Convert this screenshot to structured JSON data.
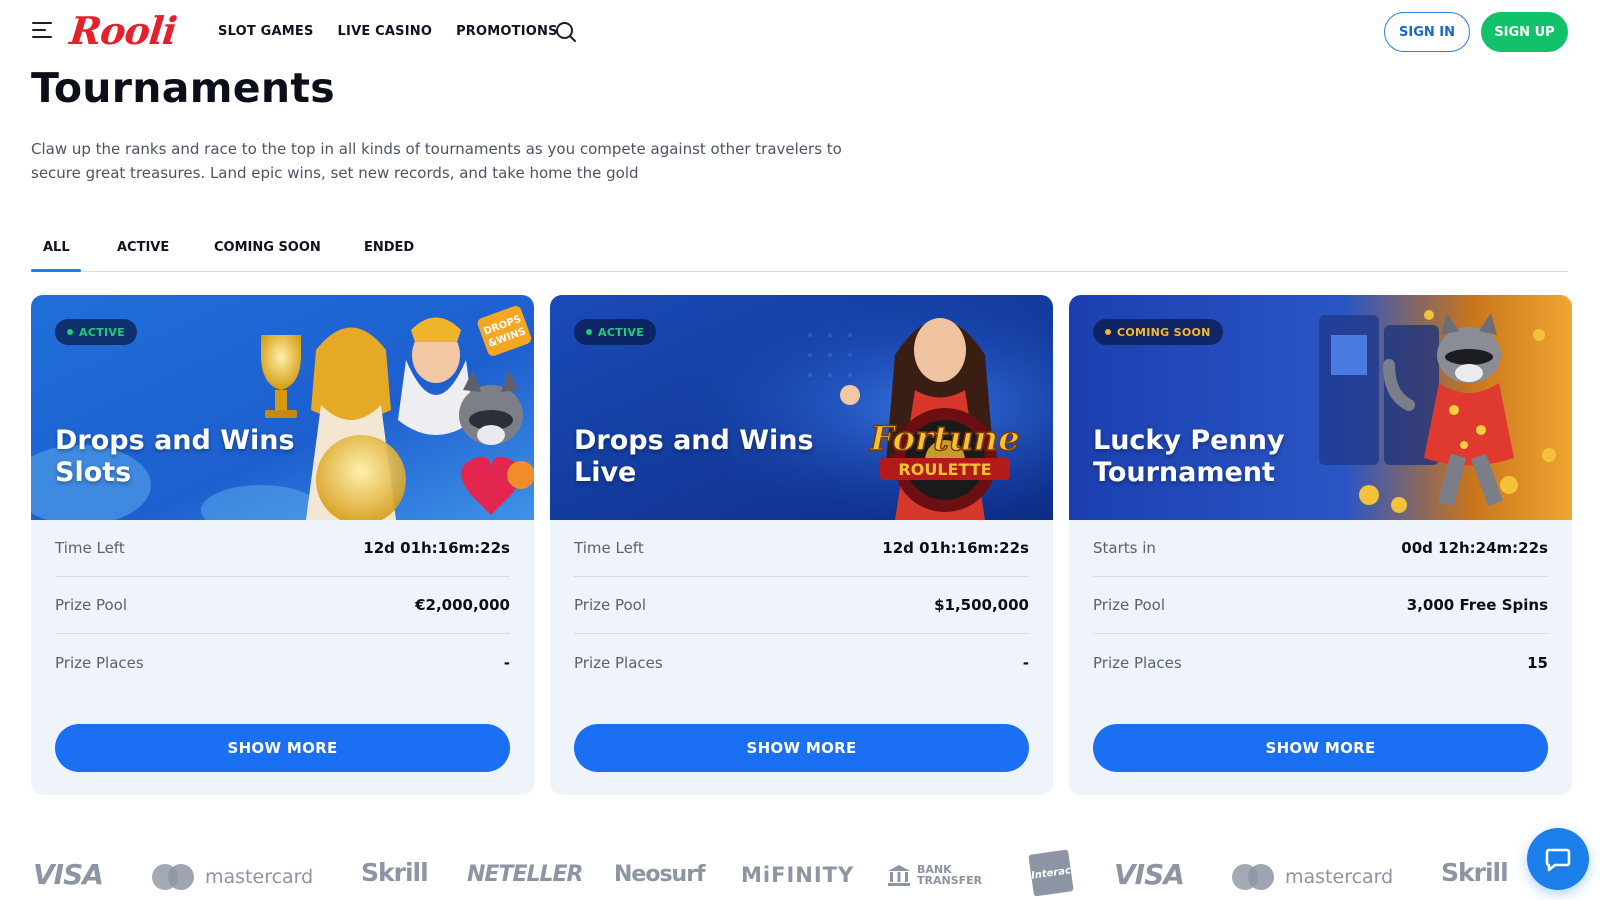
{
  "header": {
    "logo_text": "Rooli",
    "nav": [
      {
        "label": "SLOT GAMES"
      },
      {
        "label": "LIVE CASINO"
      },
      {
        "label": "PROMOTIONS"
      }
    ],
    "sign_in": "SIGN IN",
    "sign_up": "SIGN UP"
  },
  "page": {
    "title": "Tournaments",
    "intro": "Claw up the ranks and race to the top in all kinds of tournaments as you compete against other travelers to secure great treasures. Land epic wins, set new records, and take home the gold"
  },
  "tabs": [
    {
      "label": "ALL",
      "selected": true
    },
    {
      "label": "ACTIVE",
      "selected": false
    },
    {
      "label": "COMING SOON",
      "selected": false
    },
    {
      "label": "ENDED",
      "selected": false
    }
  ],
  "cards": [
    {
      "status": "ACTIVE",
      "title": "Drops and Wins Slots",
      "rows": [
        {
          "label": "Time Left",
          "value": "12d 01h:16m:22s"
        },
        {
          "label": "Prize Pool",
          "value": "€2,000,000"
        },
        {
          "label": "Prize Places",
          "value": "-"
        }
      ],
      "button": "SHOW MORE"
    },
    {
      "status": "ACTIVE",
      "title": "Drops and Wins Live",
      "rows": [
        {
          "label": "Time Left",
          "value": "12d 01h:16m:22s"
        },
        {
          "label": "Prize Pool",
          "value": "$1,500,000"
        },
        {
          "label": "Prize Places",
          "value": "-"
        }
      ],
      "button": "SHOW MORE"
    },
    {
      "status": "COMING SOON",
      "title": "Lucky Penny Tournament",
      "rows": [
        {
          "label": "Starts in",
          "value": "00d 12h:24m:22s"
        },
        {
          "label": "Prize Pool",
          "value": "3,000 Free Spins"
        },
        {
          "label": "Prize Places",
          "value": "15"
        }
      ],
      "button": "SHOW MORE"
    }
  ],
  "payments": [
    "VISA",
    "mastercard",
    "Skrill",
    "NETELLER",
    "Neosurf",
    "MiFINITY",
    "BANK TRANSFER",
    "Interac",
    "VISA",
    "mastercard",
    "Skrill"
  ],
  "colors": {
    "accent_blue": "#1a6ff2",
    "signup_green": "#11c26b",
    "logo_red": "#e3202b",
    "badge_active": "#1ecf79",
    "badge_soon": "#f4b92c"
  },
  "icons": {
    "menu": "hamburger-icon",
    "search": "search-icon",
    "chat": "chat-icon"
  }
}
